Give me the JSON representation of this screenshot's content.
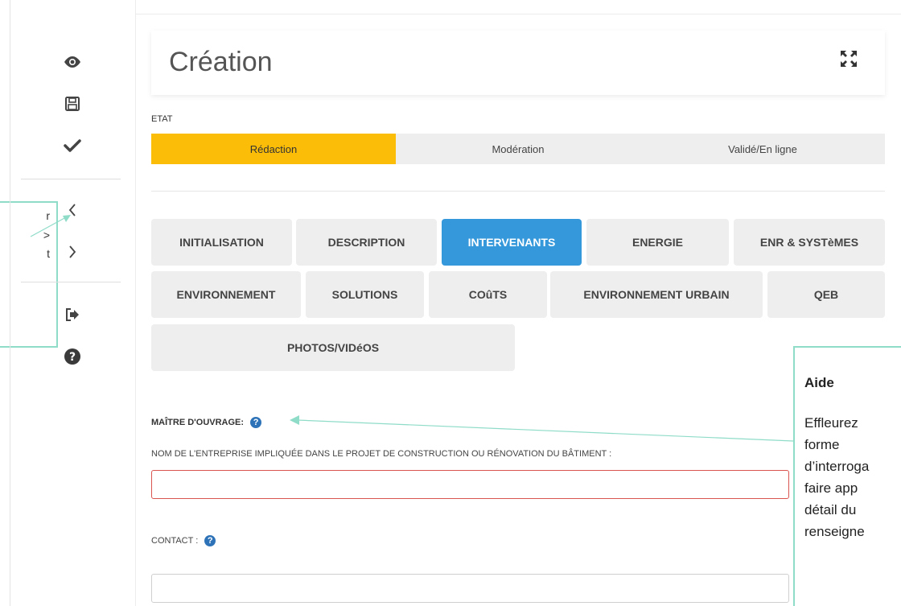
{
  "left_callout": {
    "lines": [
      "r",
      ">",
      "t"
    ]
  },
  "toolbar": {
    "icons": [
      "eye-icon",
      "save-icon",
      "check-icon",
      "chevron-left-icon",
      "chevron-right-icon",
      "logout-icon",
      "help-icon"
    ]
  },
  "header": {
    "title": "Création"
  },
  "state": {
    "label": "ETAT",
    "steps": [
      "Rédaction",
      "Modération",
      "Validé/En ligne"
    ],
    "active_index": 0
  },
  "tabs": [
    "INITIALISATION",
    "DESCRIPTION",
    "INTERVENANTS",
    "ENERGIE",
    "ENR & SYSTèMES",
    "ENVIRONNEMENT",
    "SOLUTIONS",
    "COûTS",
    "ENVIRONNEMENT URBAIN",
    "QEB",
    "PHOTOS/VIDéOS"
  ],
  "active_tab": "INTERVENANTS",
  "form": {
    "section_label": "MAÎTRE D'OUVRAGE:",
    "company_label": "NOM DE L'ENTREPRISE IMPLIQUÉE DANS LE PROJET DE CONSTRUCTION OU RÉNOVATION DU BÂTIMENT :",
    "company_value": "",
    "contact_label": "CONTACT :",
    "contact_value": ""
  },
  "help_callout": {
    "title": "Aide",
    "lines": [
      "Effleurez",
      "forme",
      "d’interroga",
      "faire app",
      "détail du",
      "renseigne"
    ]
  },
  "colors": {
    "active_state": "#fbbd08",
    "active_tab": "#3498db",
    "callout_border": "#8fdcc8",
    "help_icon": "#2e73b8",
    "invalid_border": "#d9534f"
  }
}
